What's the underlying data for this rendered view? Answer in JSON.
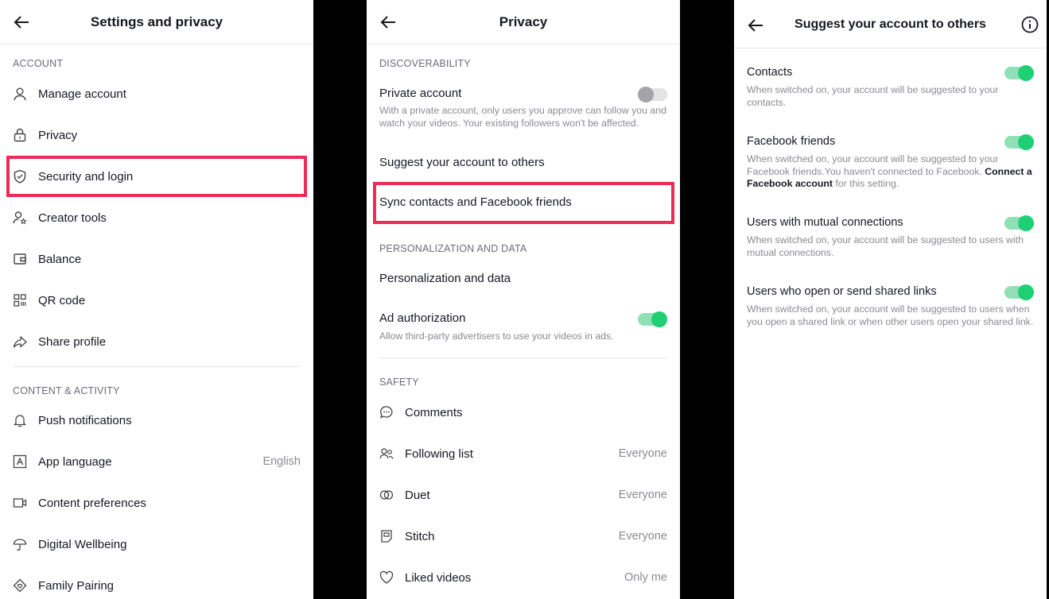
{
  "settings": {
    "title": "Settings and privacy",
    "account_section": "ACCOUNT",
    "account_items": [
      {
        "label": "Manage account",
        "icon": "person-icon"
      },
      {
        "label": "Privacy",
        "icon": "lock-icon"
      },
      {
        "label": "Security and login",
        "icon": "shield-icon"
      },
      {
        "label": "Creator tools",
        "icon": "creator-icon"
      },
      {
        "label": "Balance",
        "icon": "wallet-icon"
      },
      {
        "label": "QR code",
        "icon": "qr-icon"
      },
      {
        "label": "Share profile",
        "icon": "share-icon"
      }
    ],
    "content_section": "CONTENT & ACTIVITY",
    "content_items": [
      {
        "label": "Push notifications",
        "icon": "bell-icon"
      },
      {
        "label": "App language",
        "icon": "language-icon",
        "value": "English"
      },
      {
        "label": "Content preferences",
        "icon": "video-icon"
      },
      {
        "label": "Digital Wellbeing",
        "icon": "umbrella-icon"
      },
      {
        "label": "Family Pairing",
        "icon": "home-heart-icon"
      }
    ]
  },
  "privacy": {
    "title": "Privacy",
    "discoverability_section": "DISCOVERABILITY",
    "private_account": {
      "label": "Private account",
      "desc": "With a private account, only users you approve can follow you and watch your videos. Your existing followers won't be affected.",
      "enabled": false
    },
    "suggest_label": "Suggest your account to others",
    "sync_label": "Sync contacts and Facebook friends",
    "personalization_section": "PERSONALIZATION AND DATA",
    "personalization_label": "Personalization and data",
    "ad_auth": {
      "label": "Ad authorization",
      "desc": "Allow third-party advertisers to use your videos in ads.",
      "enabled": true
    },
    "safety_section": "SAFETY",
    "safety_items": [
      {
        "label": "Comments",
        "icon": "comment-icon",
        "value": ""
      },
      {
        "label": "Following list",
        "icon": "people-icon",
        "value": "Everyone"
      },
      {
        "label": "Duet",
        "icon": "duet-icon",
        "value": "Everyone"
      },
      {
        "label": "Stitch",
        "icon": "stitch-icon",
        "value": "Everyone"
      },
      {
        "label": "Liked videos",
        "icon": "heart-icon",
        "value": "Only me"
      }
    ]
  },
  "suggest": {
    "title": "Suggest your account to others",
    "items": [
      {
        "title": "Contacts",
        "desc": "When switched on, your account will be suggested to your contacts.",
        "enabled": true
      },
      {
        "title": "Facebook friends",
        "desc": "When switched on, your account will be suggested to your Facebook friends.You haven't connected to Facebook.",
        "link_a": "Connect a",
        "link_b": "Facebook account",
        "desc_tail": "for this setting.",
        "enabled": true
      },
      {
        "title": "Users with mutual connections",
        "desc": "When switched on, your account will be suggested to users with mutual connections.",
        "enabled": true
      },
      {
        "title": "Users who open or send shared links",
        "desc": "When switched on, your account will be suggested to users when you open a shared link or when other users open your shared link.",
        "enabled": true
      }
    ]
  },
  "colors": {
    "highlight": "#ee2a55",
    "toggle_on": "#1fcf74",
    "text": "#161823",
    "muted": "#8a8b91"
  }
}
